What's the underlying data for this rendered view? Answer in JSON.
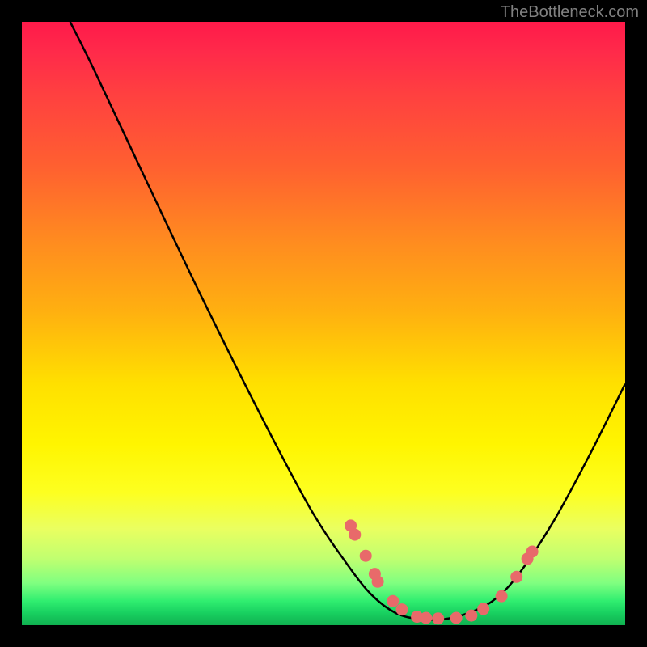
{
  "watermark": "TheBottleneck.com",
  "colors": {
    "background": "#000000",
    "curve": "#000000",
    "points": "#e86a6a",
    "gradient_top": "#ff1a4a",
    "gradient_bottom": "#10b050"
  },
  "chart_data": {
    "type": "line",
    "title": "",
    "xlabel": "",
    "ylabel": "",
    "xlim": [
      0,
      100
    ],
    "ylim": [
      0,
      100
    ],
    "curve": [
      {
        "x": 8,
        "y": 100
      },
      {
        "x": 12,
        "y": 92
      },
      {
        "x": 20,
        "y": 75
      },
      {
        "x": 30,
        "y": 54
      },
      {
        "x": 40,
        "y": 34
      },
      {
        "x": 48,
        "y": 19
      },
      {
        "x": 54,
        "y": 10
      },
      {
        "x": 58,
        "y": 5
      },
      {
        "x": 62,
        "y": 2
      },
      {
        "x": 66,
        "y": 1
      },
      {
        "x": 70,
        "y": 1
      },
      {
        "x": 74,
        "y": 2
      },
      {
        "x": 78,
        "y": 4
      },
      {
        "x": 82,
        "y": 8
      },
      {
        "x": 88,
        "y": 17
      },
      {
        "x": 94,
        "y": 28
      },
      {
        "x": 100,
        "y": 40
      }
    ],
    "points": [
      {
        "x": 54.5,
        "y": 16.5
      },
      {
        "x": 55.2,
        "y": 15.0
      },
      {
        "x": 57.0,
        "y": 11.5
      },
      {
        "x": 58.5,
        "y": 8.5
      },
      {
        "x": 59.0,
        "y": 7.2
      },
      {
        "x": 61.5,
        "y": 4.0
      },
      {
        "x": 63.0,
        "y": 2.6
      },
      {
        "x": 65.5,
        "y": 1.4
      },
      {
        "x": 67.0,
        "y": 1.2
      },
      {
        "x": 69.0,
        "y": 1.1
      },
      {
        "x": 72.0,
        "y": 1.2
      },
      {
        "x": 74.5,
        "y": 1.6
      },
      {
        "x": 76.5,
        "y": 2.7
      },
      {
        "x": 79.5,
        "y": 4.8
      },
      {
        "x": 82.0,
        "y": 8.0
      },
      {
        "x": 83.8,
        "y": 11.0
      },
      {
        "x": 84.6,
        "y": 12.2
      }
    ]
  }
}
